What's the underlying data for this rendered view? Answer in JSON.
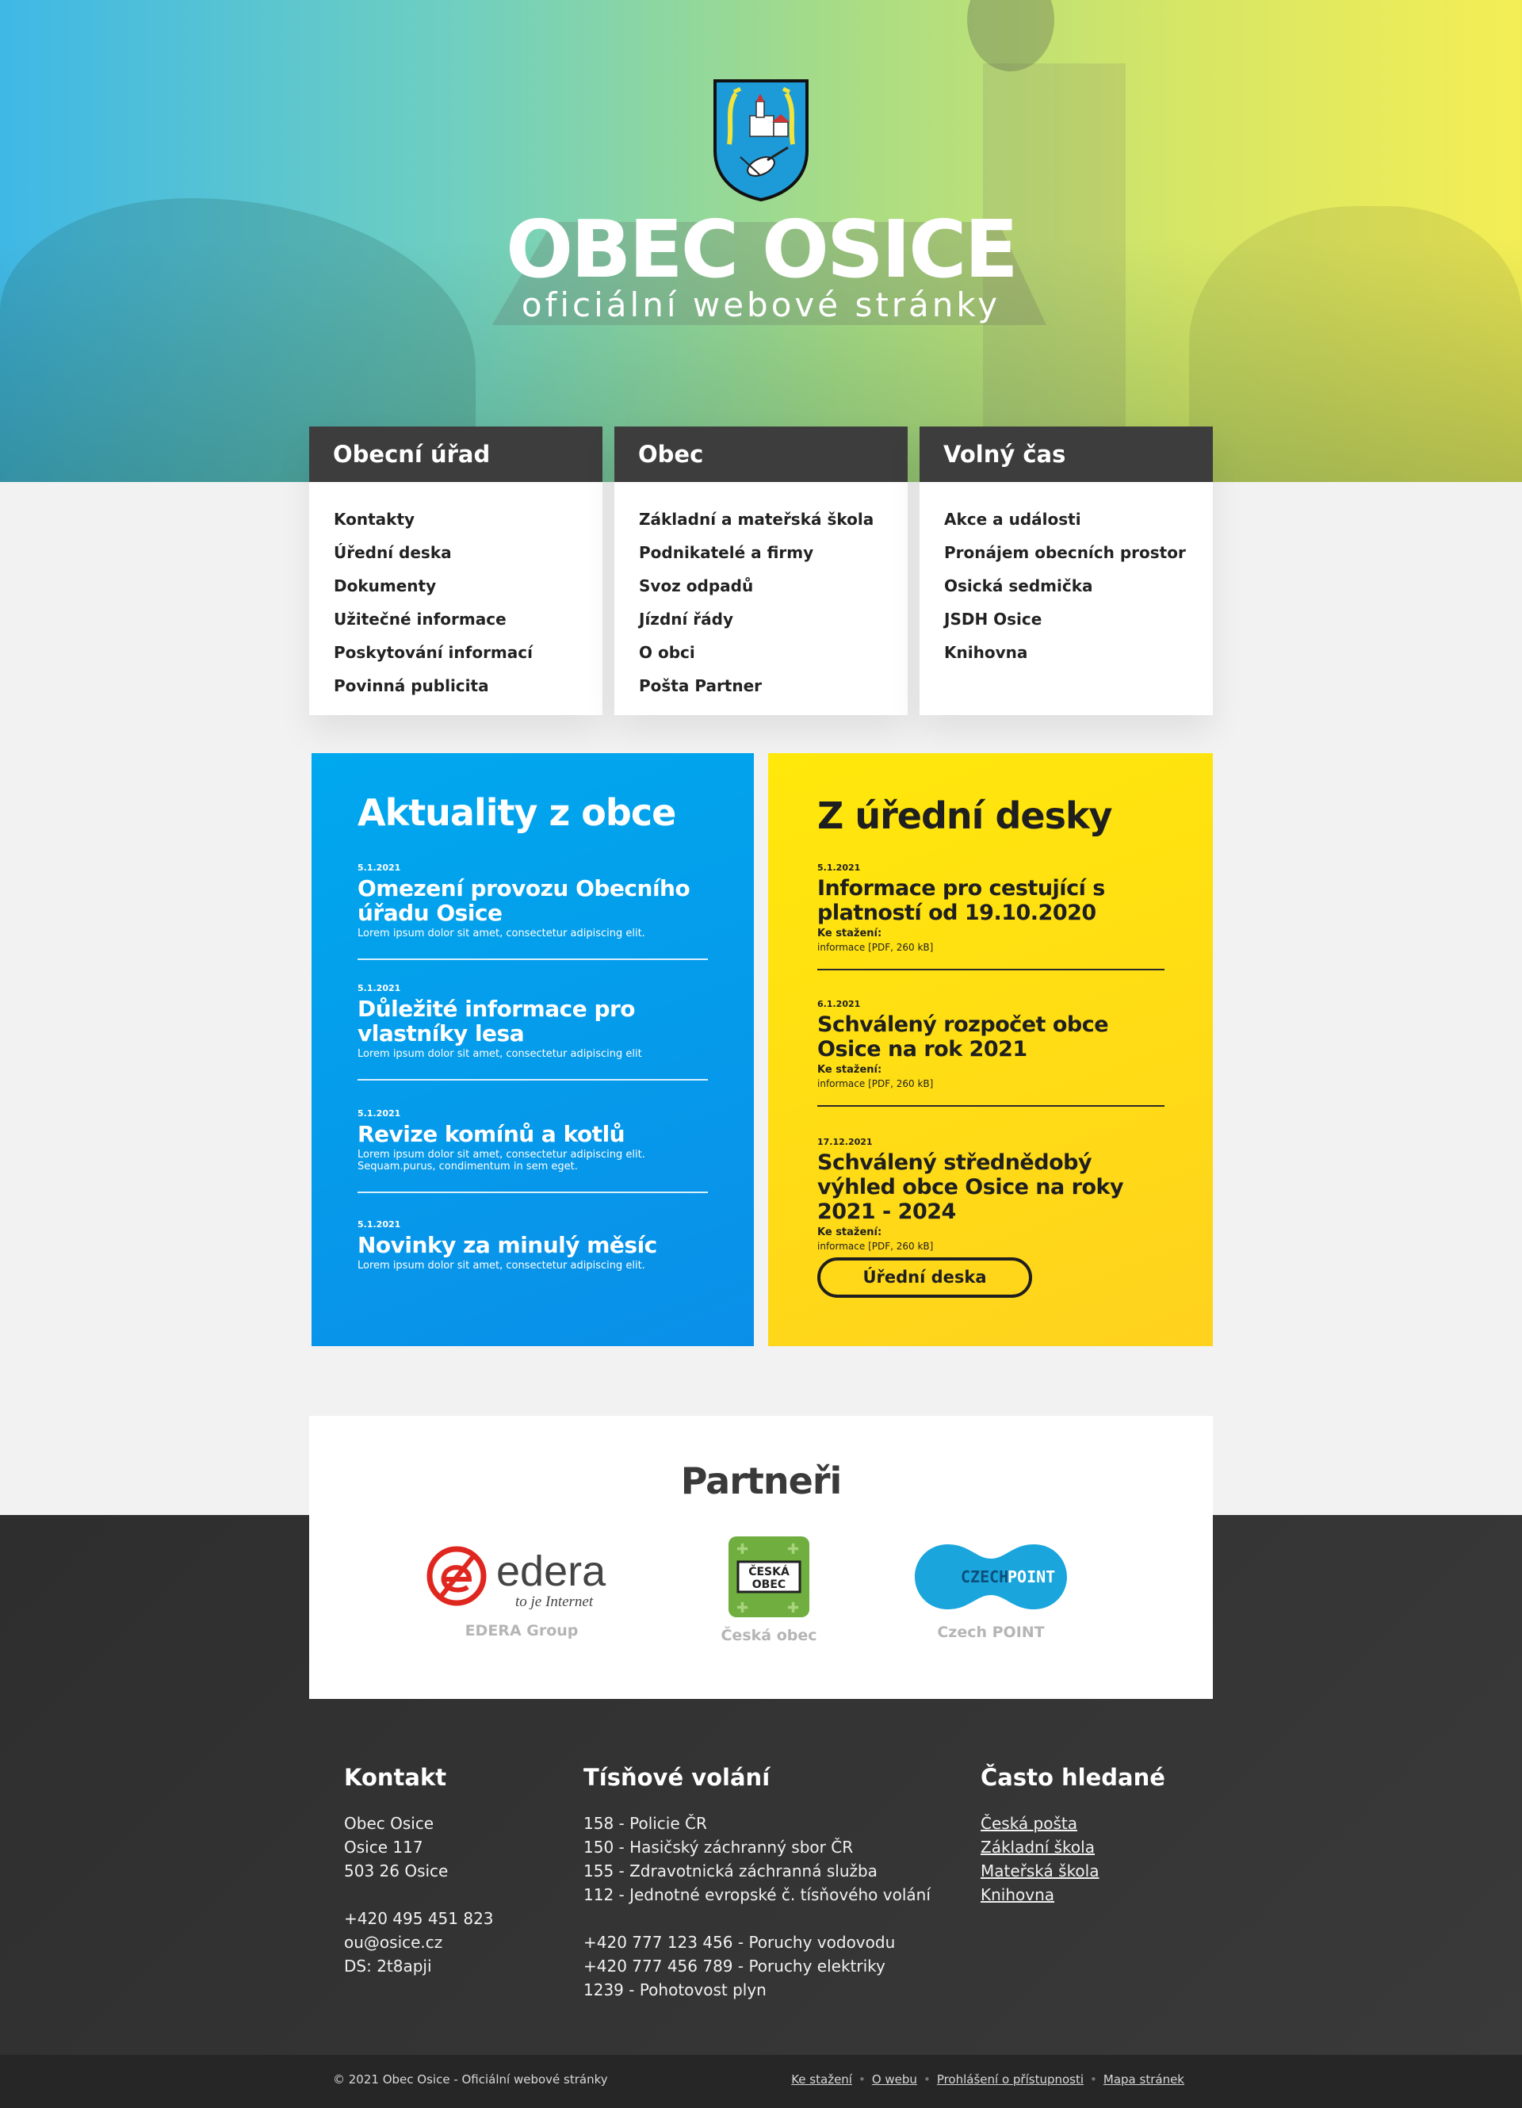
{
  "hero": {
    "title": "OBEC OSICE",
    "subtitle": "oficiální webové stránky"
  },
  "menus": [
    {
      "title": "Obecní úřad",
      "items": [
        "Kontakty",
        "Úřední deska",
        "Dokumenty",
        "Užitečné informace",
        "Poskytování informací",
        "Povinná publicita"
      ]
    },
    {
      "title": "Obec",
      "items": [
        "Základní a mateřská škola",
        "Podnikatelé a firmy",
        "Svoz odpadů",
        "Jízdní řády",
        "O obci",
        "Pošta Partner"
      ]
    },
    {
      "title": "Volný čas",
      "items": [
        "Akce a události",
        "Pronájem obecních prostor",
        "Osická sedmička",
        "JSDH Osice",
        "Knihovna"
      ]
    }
  ],
  "news": {
    "heading": "Aktuality z obce",
    "items": [
      {
        "date": "5.1.2021",
        "title": "Omezení provozu Obecního úřadu Osice",
        "desc": "Lorem ipsum dolor sit amet, consectetur adipiscing elit."
      },
      {
        "date": "5.1.2021",
        "title": "Důležité informace pro vlastníky lesa",
        "desc": "Lorem ipsum dolor sit amet, consectetur adipiscing elit"
      },
      {
        "date": "5.1.2021",
        "title": "Revize komínů a kotlů",
        "desc": "Lorem ipsum dolor sit amet, consectetur adipiscing elit. Sequam.purus, condimentum in sem eget."
      },
      {
        "date": "5.1.2021",
        "title": "Novinky za minulý měsíc",
        "desc": "Lorem ipsum dolor sit amet, consectetur adipiscing elit."
      }
    ]
  },
  "desk": {
    "heading": "Z úřední desky",
    "download_label": "Ke stažení:",
    "items": [
      {
        "date": "5.1.2021",
        "title": "Informace pro cestující s platností od 19.10.2020",
        "file": "informace [PDF, 260 kB]"
      },
      {
        "date": "6.1.2021",
        "title": "Schválený rozpočet obce Osice na rok 2021",
        "file": "informace [PDF, 260 kB]"
      },
      {
        "date": "17.12.2021",
        "title": "Schválený střednědobý výhled obce Osice na roky 2021 - 2024",
        "file": "informace [PDF, 260 kB]"
      }
    ],
    "button": "Úřední deska"
  },
  "partners": {
    "heading": "Partneři",
    "items": [
      {
        "name": "EDERA Group",
        "logo_text": "edera",
        "tagline": "to je Internet"
      },
      {
        "name": "Česká obec",
        "logo_text_1": "ČESKÁ",
        "logo_text_2": "OBEC"
      },
      {
        "name": "Czech POINT",
        "logo_text_1": "CZECH",
        "logo_text_2": "POINT"
      }
    ]
  },
  "footer": {
    "contact": {
      "heading": "Kontakt",
      "lines": [
        "Obec Osice",
        "Osice 117",
        "503 26 Osice"
      ],
      "lines2": [
        "+420 495 451 823",
        "ou@osice.cz",
        "DS: 2t8apji"
      ]
    },
    "emergency": {
      "heading": "Tísňové volání",
      "lines": [
        "158 - Policie ČR",
        "150 - Hasičský záchranný sbor ČR",
        "155 - Zdravotnická záchranná služba",
        "112 - Jednotné evropské č. tísňového volání"
      ],
      "lines2": [
        "+420 777 123 456 - Poruchy vodovodu",
        "+420 777 456 789 - Poruchy elektriky",
        "1239 - Pohotovost plyn"
      ]
    },
    "frequent": {
      "heading": "Často hledané",
      "links": [
        "Česká pošta",
        "Základní škola",
        "Mateřská škola",
        "Knihovna"
      ]
    },
    "copyright": "© 2021 Obec Osice - Oficiální webové stránky",
    "bottom_links": [
      "Ke stažení",
      "O webu",
      "Prohlášení o přístupnosti",
      "Mapa stránek"
    ]
  },
  "colors": {
    "news_blue": "#00a8ee",
    "desk_yellow": "#ffe80a",
    "dark": "#3d3d3d",
    "edera_red": "#e0271f",
    "czechpoint_blue": "#1aa6dd",
    "ceska_obec_green": "#6fae3f"
  }
}
